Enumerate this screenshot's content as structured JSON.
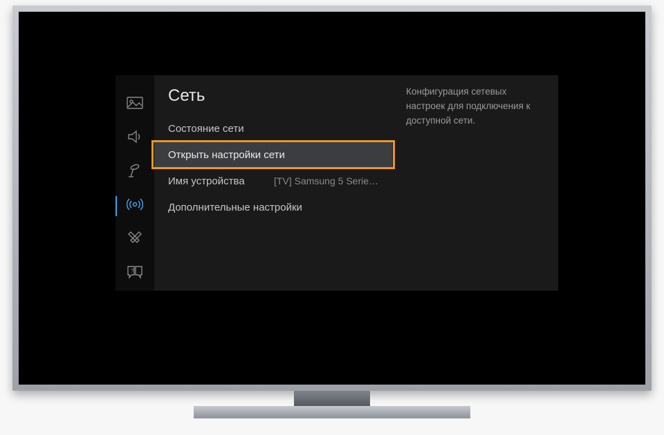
{
  "section_title": "Сеть",
  "description": "Конфигурация сетевых настроек для подключения к доступной сети.",
  "menu": {
    "status": {
      "label": "Состояние сети"
    },
    "open_settings": {
      "label": "Открыть настройки сети"
    },
    "device_name": {
      "label": "Имя устройства",
      "value": "[TV] Samsung 5 Serie…"
    },
    "advanced": {
      "label": "Дополнительные настройки"
    }
  },
  "sidebar": {
    "picture": "picture-icon",
    "sound": "sound-icon",
    "broadcast": "broadcast-icon",
    "network": "network-icon",
    "system": "system-icon",
    "support": "support-icon"
  }
}
